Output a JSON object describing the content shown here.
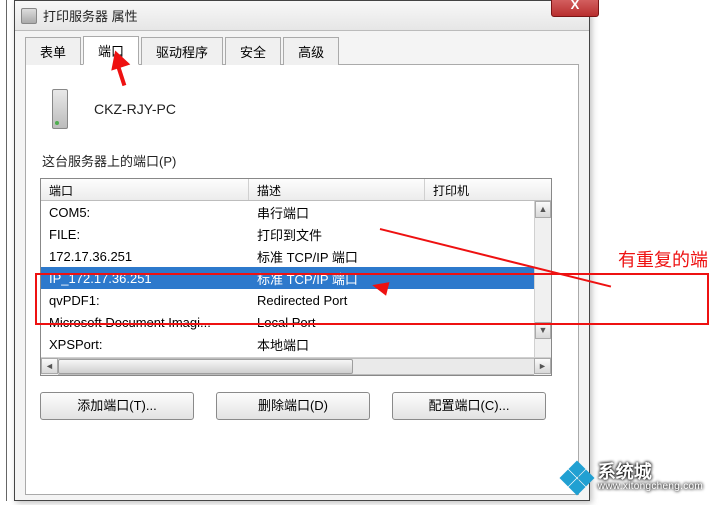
{
  "window": {
    "title": "打印服务器 属性",
    "close": "X"
  },
  "tabs": {
    "items": [
      {
        "label": "表单"
      },
      {
        "label": "端口"
      },
      {
        "label": "驱动程序"
      },
      {
        "label": "安全"
      },
      {
        "label": "高级"
      }
    ],
    "active_index": 1
  },
  "panel": {
    "server_name": "CKZ-RJY-PC",
    "section_label": "这台服务器上的端口(P)",
    "columns": {
      "port": "端口",
      "desc": "描述",
      "printer": "打印机"
    },
    "rows": [
      {
        "port": "COM5:",
        "desc": "串行端口",
        "printer": ""
      },
      {
        "port": "FILE:",
        "desc": "打印到文件",
        "printer": ""
      },
      {
        "port": "172.17.36.251",
        "desc": "标准 TCP/IP 端口",
        "printer": ""
      },
      {
        "port": "IP_172.17.36.251",
        "desc": "标准 TCP/IP 端口",
        "printer": ""
      },
      {
        "port": "qvPDF1:",
        "desc": "Redirected Port",
        "printer": ""
      },
      {
        "port": "Microsoft Document Imagi...",
        "desc": "Local Port",
        "printer": ""
      },
      {
        "port": "XPSPort:",
        "desc": "本地端口",
        "printer": ""
      }
    ],
    "selected_index": 3,
    "buttons": {
      "add": "添加端口(T)...",
      "delete": "删除端口(D)",
      "config": "配置端口(C)..."
    }
  },
  "annotation": {
    "text": "有重复的端"
  },
  "watermark": {
    "name": "系统城",
    "url": "www.xitongcheng.com"
  }
}
